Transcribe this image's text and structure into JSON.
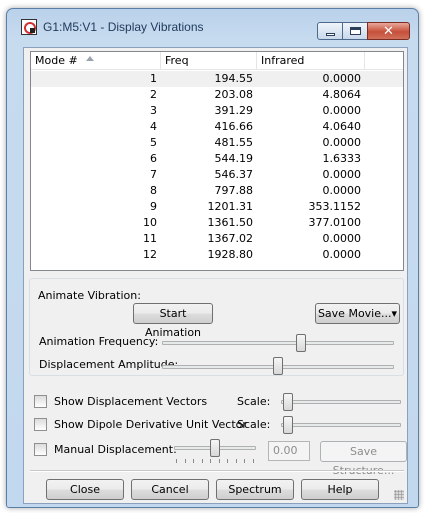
{
  "window": {
    "title": "G1:M5:V1 - Display Vibrations"
  },
  "list": {
    "columns": [
      "Mode #",
      "Freq",
      "Infrared"
    ],
    "rows": [
      {
        "mode": "1",
        "freq": "194.55",
        "ir": "0.0000"
      },
      {
        "mode": "2",
        "freq": "203.08",
        "ir": "4.8064"
      },
      {
        "mode": "3",
        "freq": "391.29",
        "ir": "0.0000"
      },
      {
        "mode": "4",
        "freq": "416.66",
        "ir": "4.0640"
      },
      {
        "mode": "5",
        "freq": "481.55",
        "ir": "0.0000"
      },
      {
        "mode": "6",
        "freq": "544.19",
        "ir": "1.6333"
      },
      {
        "mode": "7",
        "freq": "546.37",
        "ir": "0.0000"
      },
      {
        "mode": "8",
        "freq": "797.88",
        "ir": "0.0000"
      },
      {
        "mode": "9",
        "freq": "1201.31",
        "ir": "353.1152"
      },
      {
        "mode": "10",
        "freq": "1361.50",
        "ir": "377.0100"
      },
      {
        "mode": "11",
        "freq": "1367.02",
        "ir": "0.0000"
      },
      {
        "mode": "12",
        "freq": "1928.80",
        "ir": "0.0000"
      }
    ]
  },
  "animate": {
    "group_label": "Animate Vibration:",
    "start_button": "Start Animation",
    "save_movie_button": "Save Movie...",
    "frequency_label": "Animation Frequency:",
    "amplitude_label": "Displacement Amplitude:",
    "frequency_level": 0.6,
    "amplitude_level": 0.5
  },
  "options": {
    "show_displacement_vectors": "Show Displacement Vectors",
    "show_dipole_derivative": "Show Dipole Derivative Unit Vector",
    "manual_displacement": "Manual Displacement:",
    "scale_label": "Scale:",
    "manual_value": "0.00",
    "save_structure_button": "Save Structure..."
  },
  "buttons": {
    "close": "Close",
    "cancel": "Cancel",
    "spectrum": "Spectrum",
    "help": "Help"
  },
  "colors": {
    "title_text": "#1e395b",
    "close_button": "#c6503a",
    "window_frame": "#c2d8ee"
  }
}
